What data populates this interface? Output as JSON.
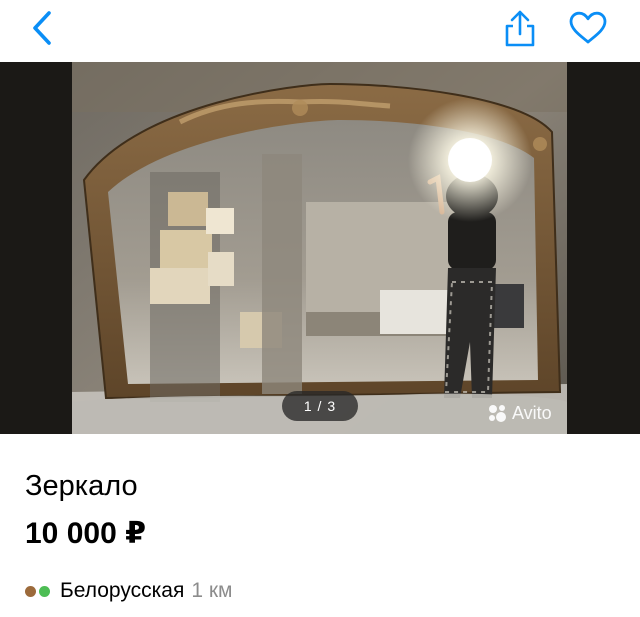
{
  "header": {
    "back_icon": "chevron-left-icon",
    "share_icon": "share-icon",
    "favorite_icon": "heart-outline-icon",
    "accent_color": "#0a8ef6"
  },
  "gallery": {
    "pager": "1 / 3",
    "watermark": "Avito"
  },
  "listing": {
    "title": "Зеркало",
    "price": "10 000 ₽",
    "metro": {
      "line_colors": [
        "#9c6a3b",
        "#4dbd54"
      ],
      "station": "Белорусская",
      "distance": "1 км"
    }
  }
}
